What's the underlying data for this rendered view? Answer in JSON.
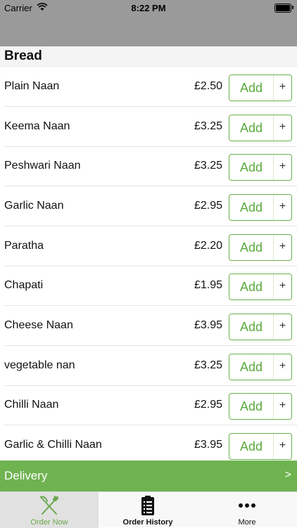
{
  "status_bar": {
    "carrier": "Carrier",
    "time": "8:22 PM"
  },
  "section": {
    "title": "Bread"
  },
  "items": [
    {
      "name": "Plain Naan",
      "price": "£2.50",
      "add_label": "Add",
      "plus_label": "+"
    },
    {
      "name": "Keema Naan",
      "price": "£3.25",
      "add_label": "Add",
      "plus_label": "+"
    },
    {
      "name": "Peshwari Naan",
      "price": "£3.25",
      "add_label": "Add",
      "plus_label": "+"
    },
    {
      "name": "Garlic Naan",
      "price": "£2.95",
      "add_label": "Add",
      "plus_label": "+"
    },
    {
      "name": "Paratha",
      "price": "£2.20",
      "add_label": "Add",
      "plus_label": "+"
    },
    {
      "name": "Chapati",
      "price": "£1.95",
      "add_label": "Add",
      "plus_label": "+"
    },
    {
      "name": "Cheese Naan",
      "price": "£3.95",
      "add_label": "Add",
      "plus_label": "+"
    },
    {
      "name": "vegetable nan",
      "price": "£3.25",
      "add_label": "Add",
      "plus_label": "+"
    },
    {
      "name": "Chilli Naan",
      "price": "£2.95",
      "add_label": "Add",
      "plus_label": "+"
    },
    {
      "name": "Garlic & Chilli Naan",
      "price": "£3.95",
      "add_label": "Add",
      "plus_label": "+"
    }
  ],
  "delivery_bar": {
    "label": "Delivery",
    "chevron": ">"
  },
  "tabs": [
    {
      "label": "Order Now",
      "icon": "fork-knife-icon",
      "active": true
    },
    {
      "label": "Order History",
      "icon": "clipboard-icon",
      "active": false
    },
    {
      "label": "More",
      "icon": "more-dots-icon",
      "active": false
    }
  ],
  "colors": {
    "accent_green": "#6fb351",
    "nav_gray": "#9a9a9a",
    "button_text_green": "#5aaa3d"
  }
}
